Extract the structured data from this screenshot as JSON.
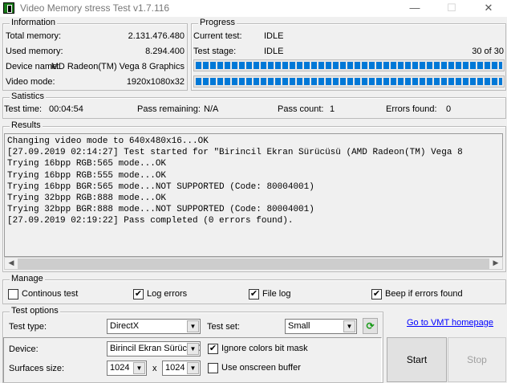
{
  "window": {
    "title": "Video Memory stress Test v1.7.116",
    "minimize": "—",
    "maximize": "☐",
    "close": "✕"
  },
  "information": {
    "label": "Information",
    "rows": [
      {
        "label": "Total memory:",
        "value": "2.131.476.480"
      },
      {
        "label": "Used memory:",
        "value": "8.294.400"
      },
      {
        "label": "Device name:",
        "value": "MD Radeon(TM) Vega 8 Graphics"
      },
      {
        "label": "Video mode:",
        "value": "1920x1080x32"
      }
    ]
  },
  "progress": {
    "label": "Progress",
    "current_test_label": "Current test:",
    "current_test": "IDLE",
    "test_stage_label": "Test stage:",
    "test_stage": "IDLE",
    "stage_count": "30 of 30",
    "bar1_percent": 100,
    "bar2_percent": 100
  },
  "statistics": {
    "label": "Satistics",
    "test_time_label": "Test time:",
    "test_time": "00:04:54",
    "pass_remaining_label": "Pass remaining:",
    "pass_remaining": "N/A",
    "pass_count_label": "Pass count:",
    "pass_count": "1",
    "errors_found_label": "Errors found:",
    "errors_found": "0"
  },
  "results": {
    "label": "Results",
    "lines": [
      "Changing video mode to 640x480x16...OK",
      "[27.09.2019 02:14:27] Test started for \"Birincil Ekran Sürücüsü (AMD Radeon(TM) Vega 8",
      "Trying 16bpp RGB:565 mode...OK",
      "Trying 16bpp RGB:555 mode...OK",
      "Trying 16bpp BGR:565 mode...NOT SUPPORTED (Code: 80004001)",
      "Trying 32bpp RGB:888 mode...OK",
      "Trying 32bpp BGR:888 mode...NOT SUPPORTED (Code: 80004001)",
      "[27.09.2019 02:19:22] Pass completed (0 errors found)."
    ]
  },
  "manage": {
    "label": "Manage",
    "continous_test": "Continous test",
    "log_errors": "Log errors",
    "file_log": "File log",
    "beep": "Beep if errors found",
    "check": "✔"
  },
  "test_options": {
    "label": "Test options",
    "test_type_label": "Test type:",
    "test_type": "DirectX",
    "test_set_label": "Test set:",
    "test_set": "Small",
    "device_label": "Device:",
    "device": "Birincil Ekran Sürücüsü",
    "ignore_mask": "Ignore colors bit mask",
    "surfaces_label": "Surfaces size:",
    "width": "1024",
    "x": "x",
    "height": "1024",
    "onscreen": "Use onscreen buffer",
    "refresh": "⟳"
  },
  "link": "Go to VMT homepage",
  "buttons": {
    "start": "Start",
    "stop": "Stop"
  },
  "colors": {
    "accent": "#0078d7",
    "link": "#0000ff"
  }
}
